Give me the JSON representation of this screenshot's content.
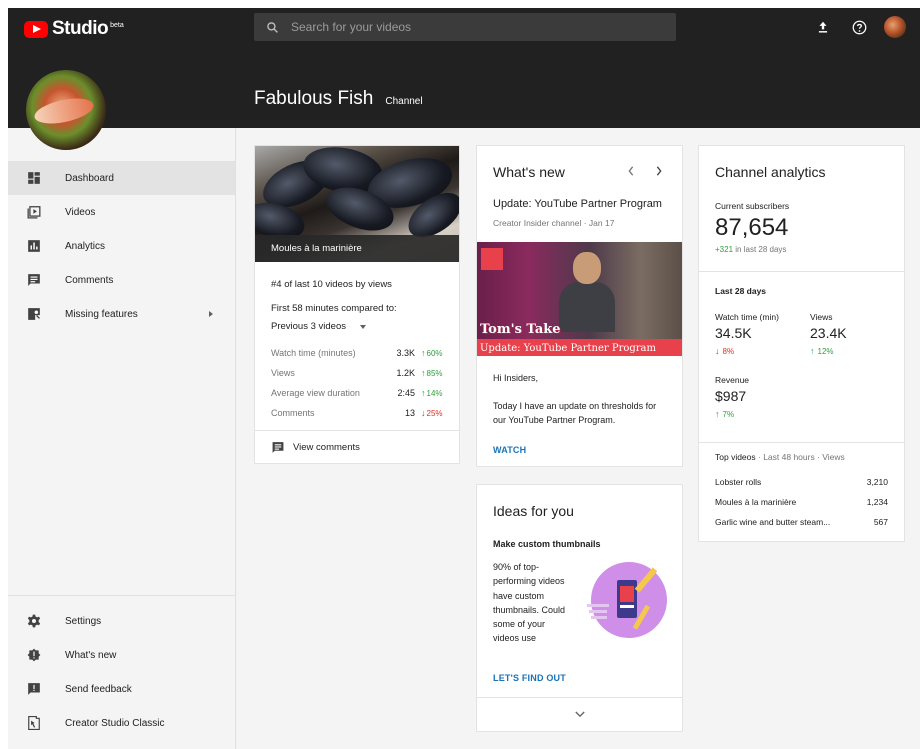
{
  "app": {
    "logo_text": "Studio",
    "logo_badge": "beta"
  },
  "search": {
    "placeholder": "Search for your videos"
  },
  "channel": {
    "name": "Fabulous Fish",
    "label": "Channel"
  },
  "sidebar": {
    "top_items": [
      {
        "label": "Dashboard",
        "icon": "dashboard-icon",
        "active": true
      },
      {
        "label": "Videos",
        "icon": "videos-icon"
      },
      {
        "label": "Analytics",
        "icon": "analytics-icon"
      },
      {
        "label": "Comments",
        "icon": "comments-icon"
      },
      {
        "label": "Missing features",
        "icon": "missing-features-icon"
      }
    ],
    "bottom_items": [
      {
        "label": "Settings",
        "icon": "gear-icon"
      },
      {
        "label": "What's new",
        "icon": "whats-new-icon"
      },
      {
        "label": "Send feedback",
        "icon": "feedback-icon"
      },
      {
        "label": "Creator Studio Classic",
        "icon": "classic-icon"
      }
    ]
  },
  "video_card": {
    "caption": "Moules à la marinière",
    "rank": "#4 of last 10 videos by views",
    "compare_text": "First 58 minutes compared to:",
    "compare_select": "Previous 3 videos",
    "stats": [
      {
        "label": "Watch time (minutes)",
        "value": "3.3K",
        "change": "60%",
        "direction": "up"
      },
      {
        "label": "Views",
        "value": "1.2K",
        "change": "85%",
        "direction": "up"
      },
      {
        "label": "Average view duration",
        "value": "2:45",
        "change": "14%",
        "direction": "up"
      },
      {
        "label": "Comments",
        "value": "13",
        "change": "25%",
        "direction": "down"
      }
    ],
    "view_comments": "View comments"
  },
  "whats_new": {
    "title": "What's new",
    "headline": "Update: YouTube Partner Program",
    "sub": "Creator Insider channel · Jan 17",
    "image_title": "Tom's Take",
    "image_sub": "Update: YouTube Partner Program",
    "body_1": "Hi Insiders,",
    "body_2": "Today I have an update on thresholds for our YouTube Partner Program.",
    "action": "WATCH"
  },
  "ideas": {
    "title": "Ideas for you",
    "subtitle": "Make custom thumbnails",
    "text": "90% of top-performing videos have custom thumbnails. Could some of your videos use",
    "action": "LET'S FIND OUT"
  },
  "analytics": {
    "title": "Channel analytics",
    "subs_label": "Current subscribers",
    "subs_value": "87,654",
    "subs_change": "+321",
    "subs_change_suffix": "in last 28 days",
    "period_label": "Last 28 days",
    "metrics": [
      {
        "label": "Watch time (min)",
        "value": "34.5K",
        "change": "8%",
        "direction": "down"
      },
      {
        "label": "Views",
        "value": "23.4K",
        "change": "12%",
        "direction": "up"
      },
      {
        "label": "Revenue",
        "value": "$987",
        "change": "7%",
        "direction": "up"
      }
    ],
    "top_videos_label": "Top videos",
    "top_videos_meta": "· Last 48 hours · Views",
    "top_videos": [
      {
        "title": "Lobster rolls",
        "views": "3,210"
      },
      {
        "title": "Moules à la marinière",
        "views": "1,234"
      },
      {
        "title": "Garlic wine and butter steam...",
        "views": "567"
      }
    ]
  },
  "colors": {
    "topbar": "#212121",
    "brand_red": "#ff0000",
    "link_blue": "#1a73b8",
    "positive": "#2e9f3e",
    "negative": "#d93025"
  }
}
